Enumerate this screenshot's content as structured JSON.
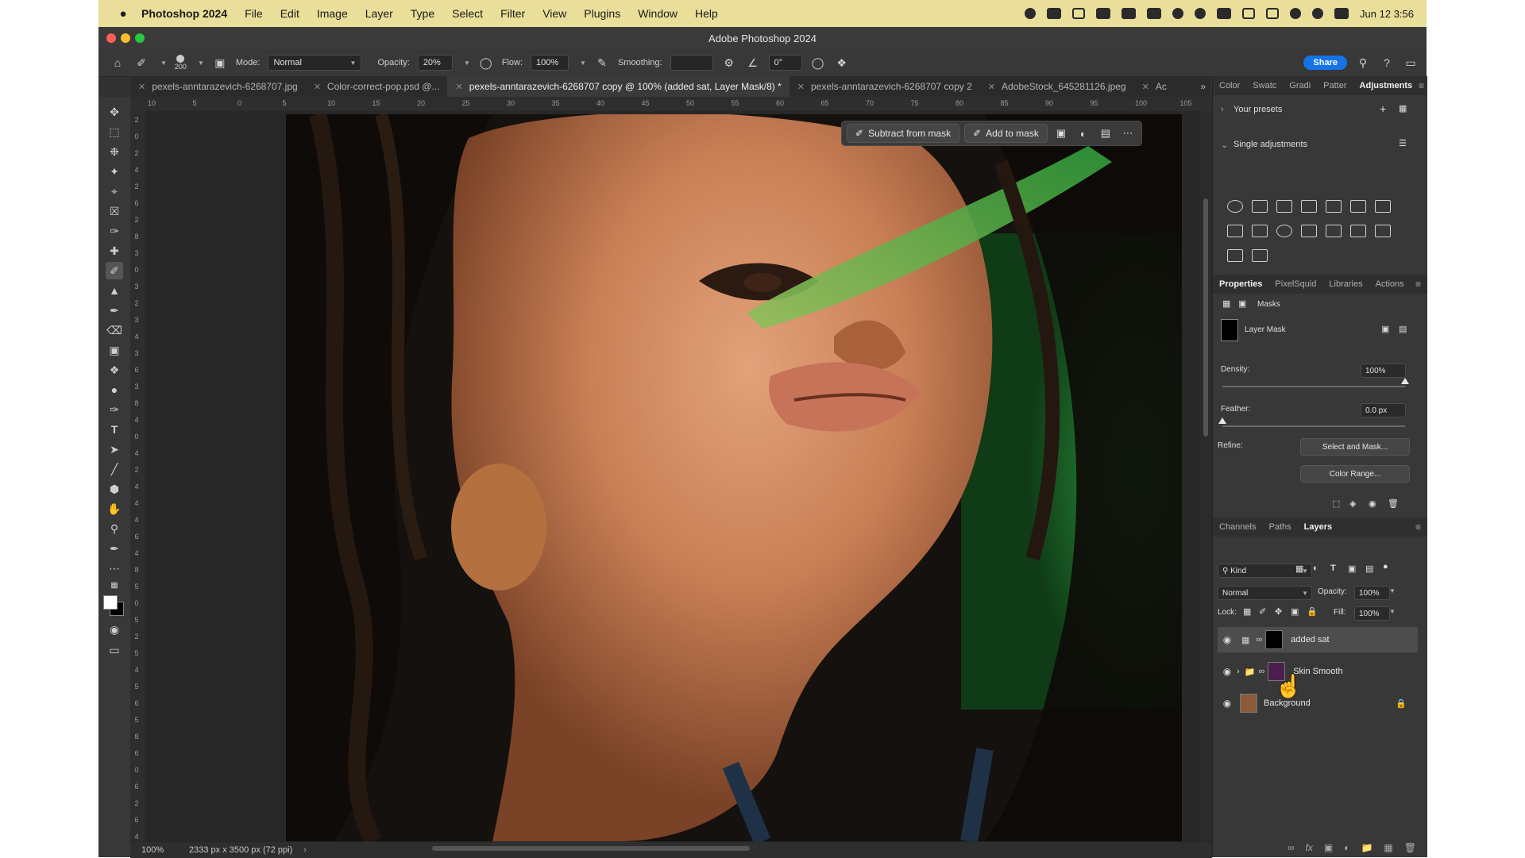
{
  "menubar": {
    "apple": "",
    "app_name": "Photoshop 2024",
    "items": [
      "File",
      "Edit",
      "Image",
      "Layer",
      "Type",
      "Select",
      "Filter",
      "View",
      "Plugins",
      "Window",
      "Help"
    ],
    "date_time": "Jun 12  3:56"
  },
  "window": {
    "title": "Adobe Photoshop 2024"
  },
  "options": {
    "brush_size": "200",
    "mode_label": "Mode:",
    "mode_value": "Normal",
    "opacity_label": "Opacity:",
    "opacity_value": "20%",
    "flow_label": "Flow:",
    "flow_value": "100%",
    "smoothing_label": "Smoothing:",
    "smoothing_value": "",
    "angle_value": "0°",
    "share_label": "Share"
  },
  "tabs": [
    {
      "label": "pexels-anntarazevich-6268707.jpg",
      "active": false
    },
    {
      "label": "Color-correct-pop.psd @...",
      "active": false
    },
    {
      "label": "pexels-anntarazevich-6268707 copy @ 100% (added sat, Layer Mask/8) *",
      "active": true
    },
    {
      "label": "pexels-anntarazevich-6268707 copy 2",
      "active": false
    },
    {
      "label": "AdobeStock_645281126.jpeg",
      "active": false
    },
    {
      "label": "Ac",
      "active": false
    }
  ],
  "ruler_top": [
    "10",
    "5",
    "0",
    "5",
    "10",
    "15",
    "20",
    "25",
    "30",
    "35",
    "40",
    "45",
    "50",
    "55",
    "60",
    "65",
    "70",
    "75",
    "80",
    "85",
    "90",
    "95",
    "100",
    "105"
  ],
  "ruler_left": [
    "2",
    "0",
    "2",
    "4",
    "2",
    "6",
    "2",
    "8",
    "3",
    "0",
    "3",
    "2",
    "3",
    "4",
    "3",
    "6",
    "3",
    "8",
    "4",
    "0",
    "4",
    "2",
    "4",
    "4",
    "4",
    "6",
    "4",
    "8",
    "5",
    "0",
    "5",
    "2",
    "5",
    "4",
    "5",
    "6",
    "5",
    "8",
    "6",
    "0",
    "6",
    "2",
    "6",
    "4"
  ],
  "context_bar": {
    "subtract_label": "Subtract from mask",
    "add_label": "Add to mask"
  },
  "status": {
    "zoom": "100%",
    "doc_info": "2333 px x 3500 px (72 ppi)"
  },
  "adjust_panel": {
    "tabs": [
      "Color",
      "Swatc",
      "Gradi",
      "Patter",
      "Adjustments"
    ],
    "your_presets": "Your presets",
    "single_adjustments": "Single adjustments"
  },
  "properties_panel": {
    "tabs": [
      "Properties",
      "PixelSquid",
      "Libraries",
      "Actions"
    ],
    "masks_label": "Masks",
    "layer_mask_label": "Layer Mask",
    "density_label": "Density:",
    "density_value": "100%",
    "density_fraction": 1.0,
    "feather_label": "Feather:",
    "feather_value": "0.0 px",
    "feather_fraction": 0.0,
    "refine_label": "Refine:",
    "select_and_mask": "Select and Mask...",
    "color_range": "Color Range..."
  },
  "layers_panel": {
    "tabs": [
      "Channels",
      "Paths",
      "Layers"
    ],
    "filter_kind": "Kind",
    "blend_mode": "Normal",
    "opacity_label": "Opacity:",
    "opacity_value": "100%",
    "lock_label": "Lock:",
    "fill_label": "Fill:",
    "fill_value": "100%",
    "layers": [
      {
        "name": "added sat",
        "selected": true
      },
      {
        "name": "Skin Smooth",
        "selected": false
      },
      {
        "name": "Background",
        "selected": false
      }
    ]
  },
  "colors": {
    "accent": "#1473e6",
    "menubar_bg": "#e9df9a",
    "panel_bg": "#383838",
    "canvas_bg": "#282828"
  }
}
